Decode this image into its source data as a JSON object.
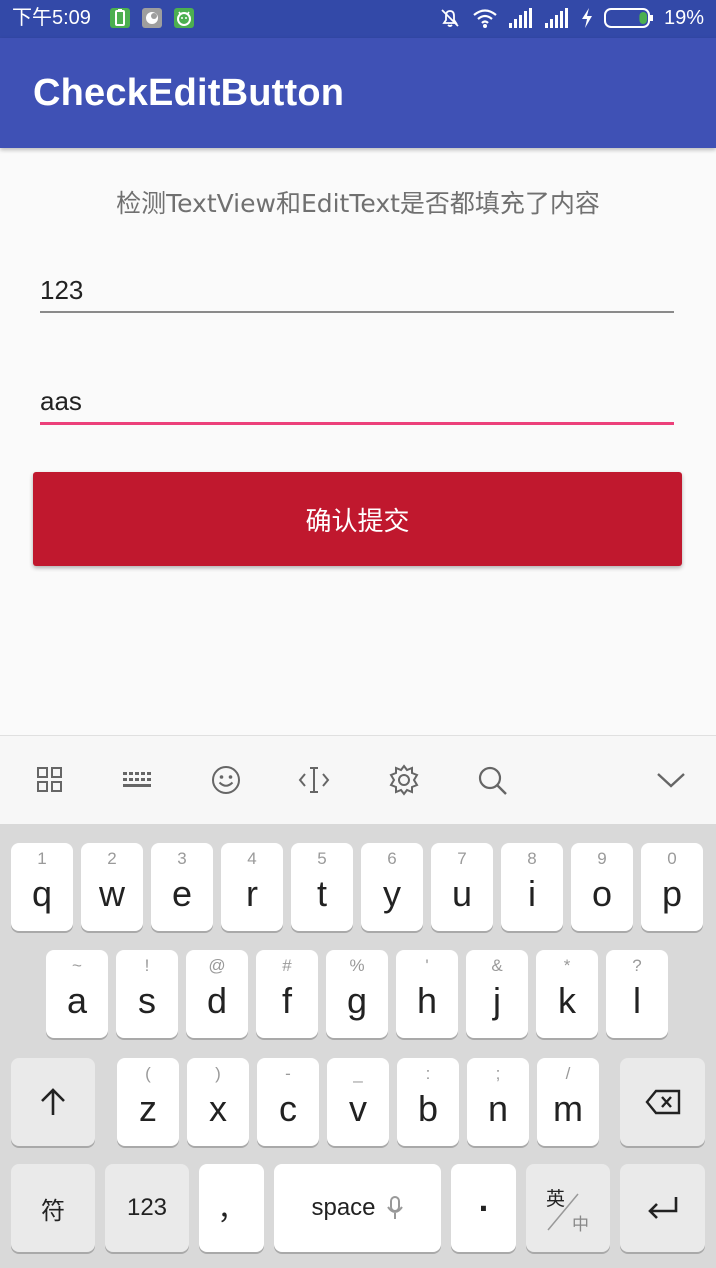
{
  "status_bar": {
    "time": "下午5:09",
    "battery_percent": "19%",
    "battery_level": 0.19,
    "notification_icons": [
      "battery-notify-icon",
      "circle-app-icon",
      "android-app-icon"
    ],
    "colors": {
      "notify_green": "#4caf50",
      "notify_gray": "#9e9e9e"
    }
  },
  "app_bar": {
    "title": "CheckEditButton",
    "color": "#3f51b5"
  },
  "main": {
    "subtitle": "检测TextView和EditText是否都填充了内容",
    "field1": {
      "value": "123"
    },
    "field2": {
      "value": "aas",
      "accent": "#ec407a"
    },
    "submit_label": "确认提交",
    "submit_color": "#c0182e"
  },
  "keyboard": {
    "toolbar_icons": [
      "grid-icon",
      "keyboard-icon",
      "emoji-icon",
      "cursor-icon",
      "settings-icon",
      "search-icon",
      "collapse-icon"
    ],
    "row1": [
      {
        "hint": "1",
        "key": "q"
      },
      {
        "hint": "2",
        "key": "w"
      },
      {
        "hint": "3",
        "key": "e"
      },
      {
        "hint": "4",
        "key": "r"
      },
      {
        "hint": "5",
        "key": "t"
      },
      {
        "hint": "6",
        "key": "y"
      },
      {
        "hint": "7",
        "key": "u"
      },
      {
        "hint": "8",
        "key": "i"
      },
      {
        "hint": "9",
        "key": "o"
      },
      {
        "hint": "0",
        "key": "p"
      }
    ],
    "row2": [
      {
        "hint": "~",
        "key": "a"
      },
      {
        "hint": "!",
        "key": "s"
      },
      {
        "hint": "@",
        "key": "d"
      },
      {
        "hint": "#",
        "key": "f"
      },
      {
        "hint": "%",
        "key": "g"
      },
      {
        "hint": "'",
        "key": "h"
      },
      {
        "hint": "&",
        "key": "j"
      },
      {
        "hint": "*",
        "key": "k"
      },
      {
        "hint": "?",
        "key": "l"
      }
    ],
    "row3": [
      {
        "hint": "(",
        "key": "z"
      },
      {
        "hint": ")",
        "key": "x"
      },
      {
        "hint": "-",
        "key": "c"
      },
      {
        "hint": "_",
        "key": "v"
      },
      {
        "hint": ":",
        "key": "b"
      },
      {
        "hint": ";",
        "key": "n"
      },
      {
        "hint": "/",
        "key": "m"
      }
    ],
    "symbols_label": "符",
    "numbers_label": "123",
    "comma_label": "，",
    "space_label": "space",
    "period_label": "·",
    "lang_top": "英",
    "lang_bottom": "中"
  }
}
